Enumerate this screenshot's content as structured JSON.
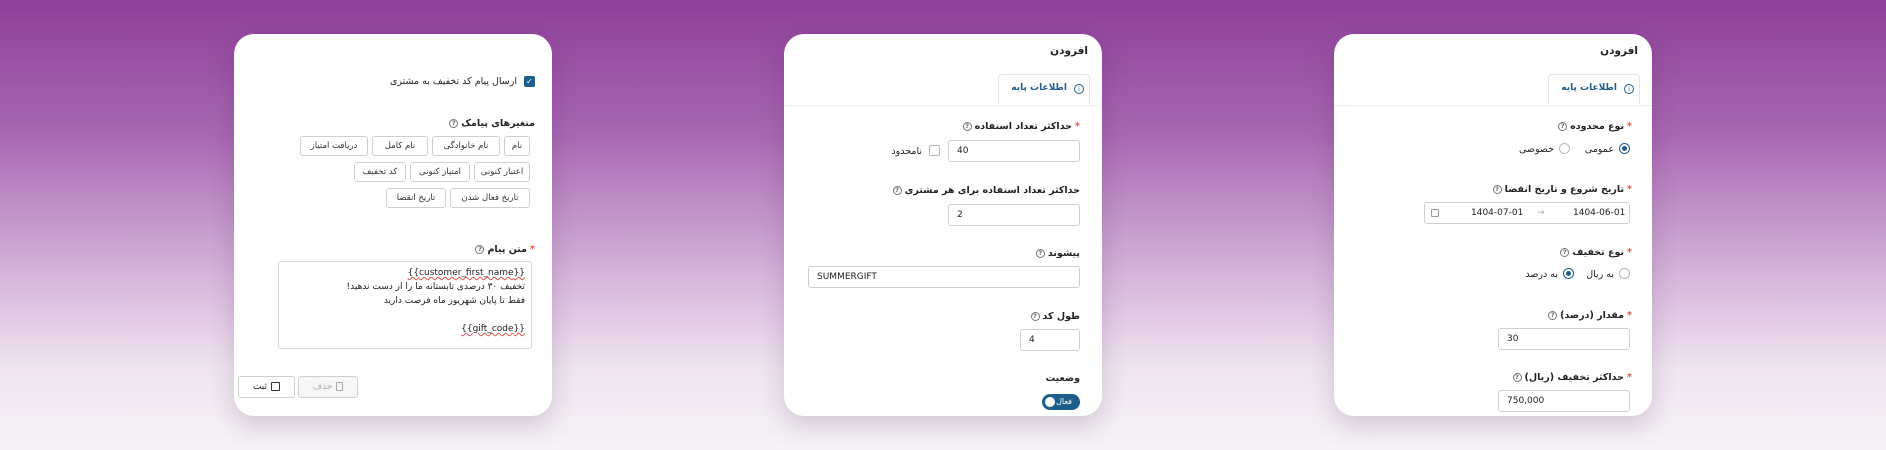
{
  "card1": {
    "send_checkbox_label": "ارسال پیام کد تخفیف به مشتری",
    "sms_vars_label": "متغیرهای پیامک",
    "sms_vars": [
      "نام",
      "نام خانوادگی",
      "نام کامل",
      "دریافت امتیاز",
      "اعتبار کنونی",
      "امتیاز کنونی",
      "کد تخفیف",
      "تاریخ فعال شدن",
      "تاریخ انقضا"
    ],
    "message_label": "متن پیام",
    "message_line1": "{{customer_first_name}}",
    "message_line2": "تخفیف ۳۰ درصدی تابستانه ما را از دست ندهید!",
    "message_line3": "فقط تا پایان شهریور ماه فرصت دارید",
    "message_line5": "{{gift_code}}",
    "save_label": "ثبت",
    "delete_label": "حذف"
  },
  "card2": {
    "title": "افزودن",
    "tab_label": "اطلاعات پایه",
    "max_use_label": "حداکثر تعداد استفاده",
    "max_use_value": "40",
    "unlimited_label": "نامحدود",
    "max_per_customer_label": "حداکثر تعداد استفاده برای هر مشتری",
    "max_per_customer_value": "2",
    "prefix_label": "پیشوند",
    "prefix_value": "SUMMERGIFT",
    "code_length_label": "طول کد",
    "code_length_value": "4",
    "status_label": "وضعیت",
    "status_toggle_label": "فعال"
  },
  "card3": {
    "title": "افزودن",
    "tab_label": "اطلاعات پایه",
    "scope_label": "نوع محدوده",
    "scope_public": "عمومی",
    "scope_private": "خصوصی",
    "date_range_label": "تاریخ شروع و تاریخ انقضا",
    "start_date": "1404-06-01",
    "end_date": "1404-07-01",
    "discount_type_label": "نوع تخفیف",
    "type_rial": "به ریال",
    "type_percent": "به درصد",
    "amount_label": "مقدار (درصد)",
    "amount_value": "30",
    "max_discount_label": "حداکثر تخفیف (ریال)",
    "max_discount_value": "750,000"
  },
  "colors": {
    "accent": "#1d5f8a",
    "required": "#d9534f"
  },
  "icons": [
    "check-icon",
    "help-icon",
    "info-icon",
    "save-icon",
    "trash-icon",
    "calendar-icon",
    "arrow-icon"
  ]
}
